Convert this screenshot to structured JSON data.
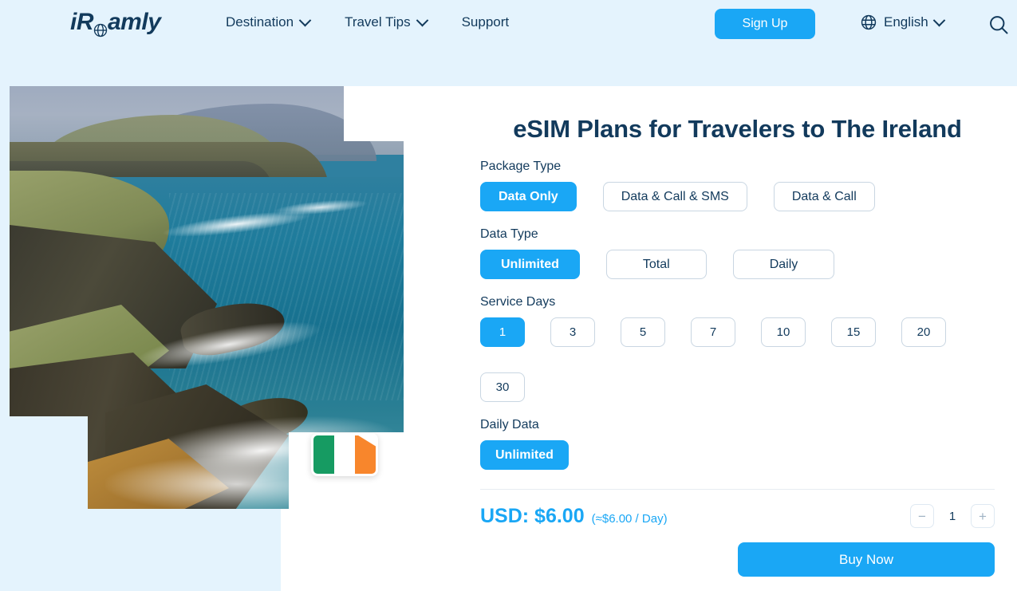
{
  "header": {
    "logo_text": "iRoamly",
    "logo_icon": "globe-icon",
    "nav": [
      {
        "label": "Destination",
        "has_chevron": true
      },
      {
        "label": "Travel Tips",
        "has_chevron": true
      },
      {
        "label": "Support",
        "has_chevron": false
      }
    ],
    "signup_label": "Sign Up",
    "language_label": "English",
    "language_icon": "globe-icon",
    "search_icon": "search-icon",
    "background_color": "#e4f3fd"
  },
  "hero": {
    "image_alt": "Irish coastal cliffs and ocean",
    "flag_badge": {
      "country": "Ireland",
      "colors": [
        "#169b62",
        "#ffffff",
        "#f8862c"
      ]
    }
  },
  "main": {
    "title": "eSIM Plans for Travelers to The Ireland",
    "groups": [
      {
        "label": "Package Type",
        "options": [
          {
            "label": "Data Only",
            "selected": true
          },
          {
            "label": "Data & Call & SMS",
            "selected": false
          },
          {
            "label": "Data & Call",
            "selected": false
          }
        ]
      },
      {
        "label": "Data Type",
        "options": [
          {
            "label": "Unlimited",
            "selected": true
          },
          {
            "label": "Total",
            "selected": false
          },
          {
            "label": "Daily",
            "selected": false
          }
        ]
      }
    ],
    "service_days": {
      "label": "Service Days",
      "options": [
        {
          "label": "1",
          "selected": true
        },
        {
          "label": "3",
          "selected": false
        },
        {
          "label": "5",
          "selected": false
        },
        {
          "label": "7",
          "selected": false
        },
        {
          "label": "10",
          "selected": false
        },
        {
          "label": "15",
          "selected": false
        },
        {
          "label": "20",
          "selected": false
        },
        {
          "label": "30",
          "selected": false
        }
      ]
    },
    "daily_data": {
      "label": "Daily Data",
      "options": [
        {
          "label": "Unlimited",
          "selected": true
        }
      ]
    },
    "price": {
      "main": "USD: $6.00",
      "per_day": "(≈$6.00 / Day)",
      "quantity": "1",
      "decrease_label": "−",
      "increase_label": "+"
    },
    "buy_label": "Buy Now"
  },
  "colors": {
    "accent": "#1aa7f5",
    "navy": "#123a5c",
    "tint": "#e4f3fd",
    "border": "#c9d6e2"
  }
}
